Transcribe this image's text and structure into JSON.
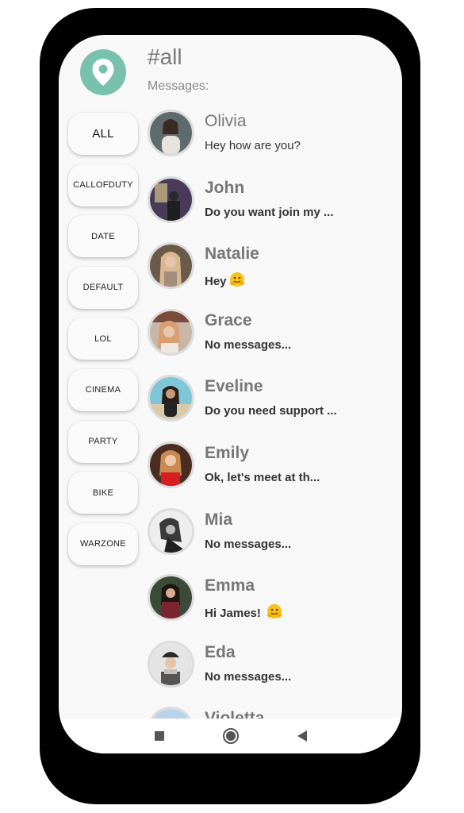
{
  "header": {
    "title": "#all",
    "subtitle": "Messages:"
  },
  "channels": [
    "ALL",
    "CALLOFDUTY",
    "DATE",
    "DEFAULT",
    "LOL",
    "CINEMA",
    "PARTY",
    "BIKE",
    "WARZONE"
  ],
  "messages": [
    {
      "name": "Olivia",
      "text": "Hey how are you?",
      "emoji": ""
    },
    {
      "name": "John",
      "text": "Do you want join my ...",
      "emoji": ""
    },
    {
      "name": "Natalie",
      "text": "Hey",
      "emoji": "hugging-face-emoji"
    },
    {
      "name": "Grace",
      "text": "No messages...",
      "emoji": ""
    },
    {
      "name": "Eveline",
      "text": "Do you need support ...",
      "emoji": ""
    },
    {
      "name": "Emily",
      "text": "Ok, let's meet at th...",
      "emoji": ""
    },
    {
      "name": "Mia",
      "text": "No messages...",
      "emoji": ""
    },
    {
      "name": "Emma",
      "text": "Hi James! ",
      "emoji": "hugging-face-emoji"
    },
    {
      "name": "Eda",
      "text": "No messages...",
      "emoji": ""
    },
    {
      "name": "Violetta",
      "text": "",
      "emoji": ""
    }
  ],
  "colors": {
    "accent": "#78c2ad",
    "phone_frame": "#000000",
    "screen_bg": "#f8f8f8"
  },
  "icons": {
    "logo": "location-pin-icon",
    "nav": [
      "square-recents-icon",
      "circle-home-icon",
      "triangle-back-icon"
    ]
  }
}
